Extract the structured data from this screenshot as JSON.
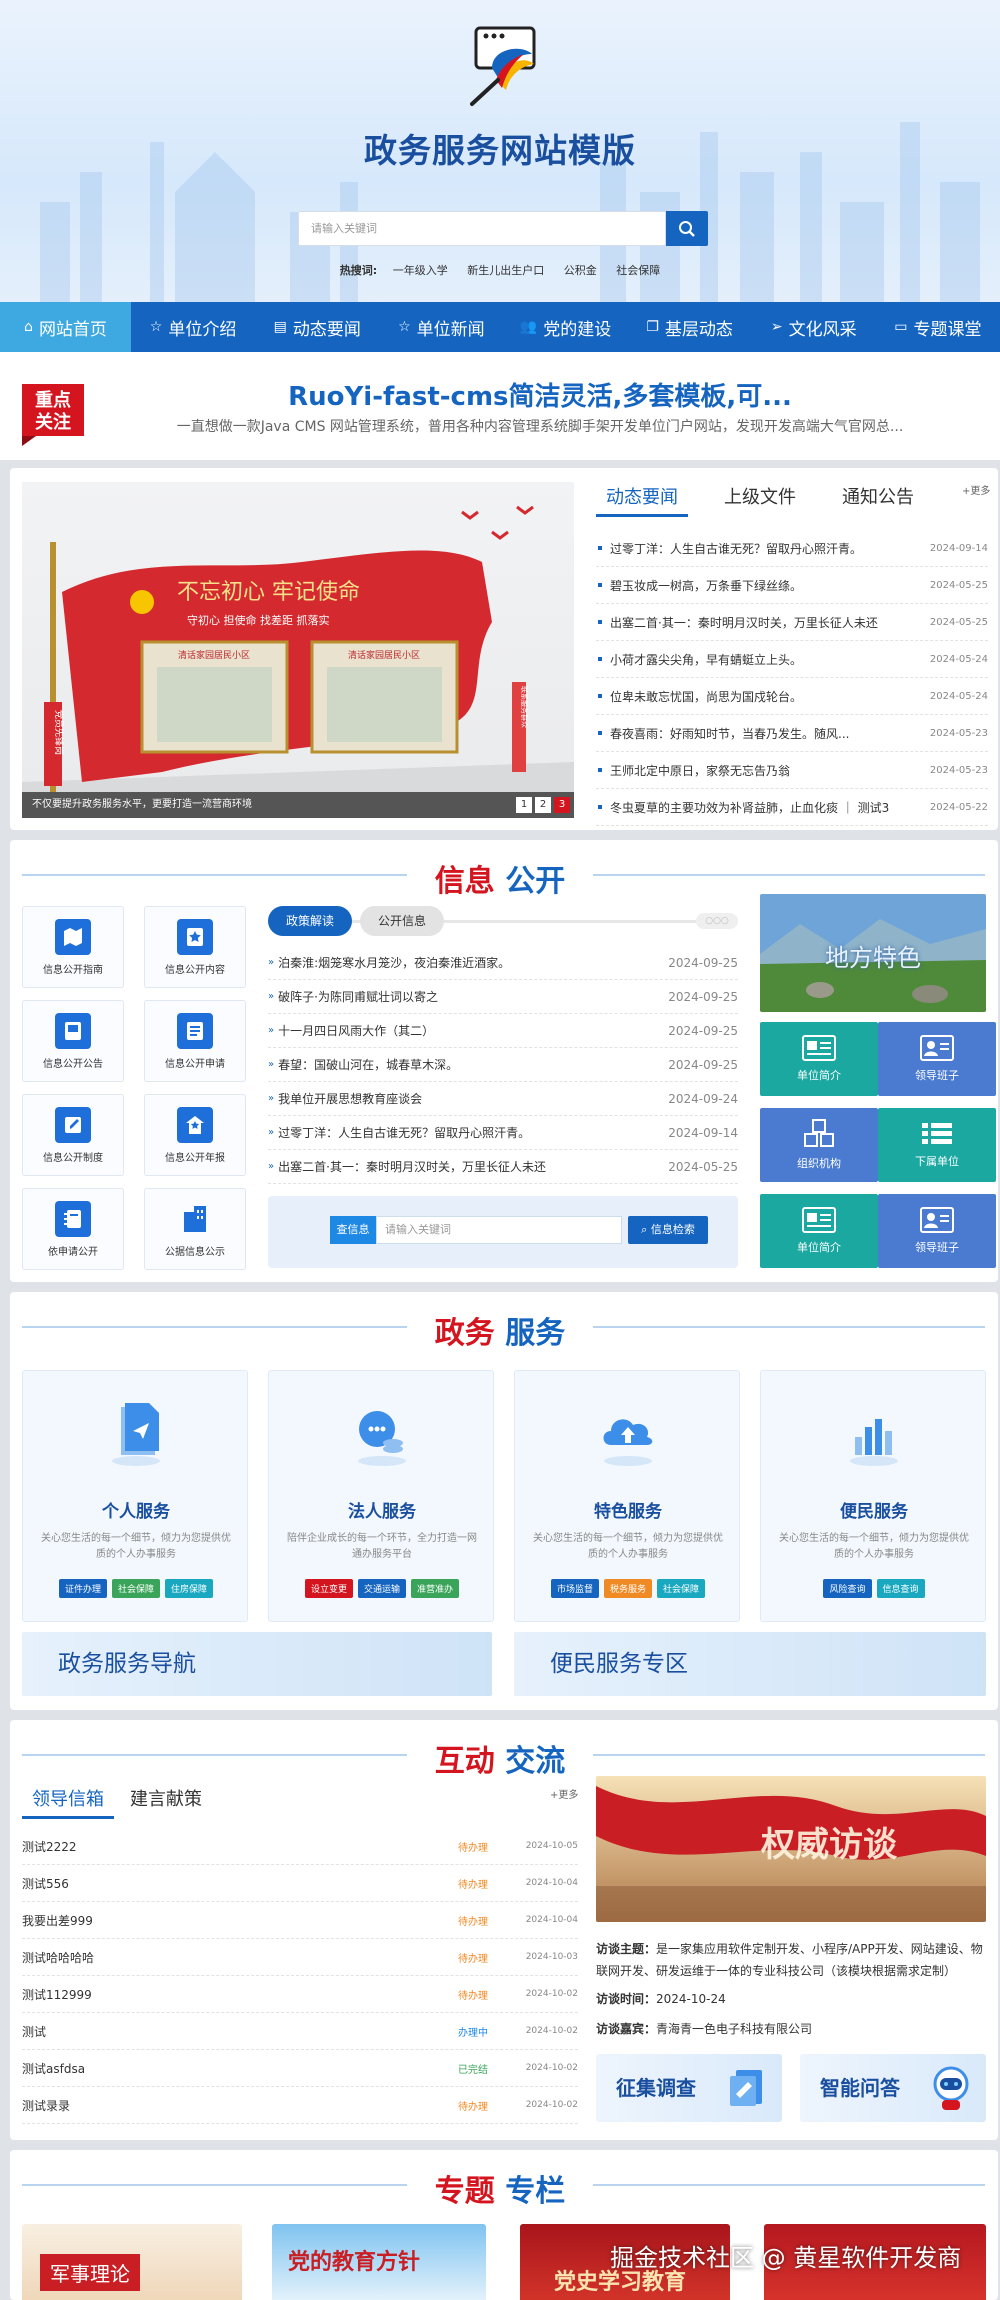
{
  "header": {
    "site_title": "政务服务网站模版",
    "search_placeholder": "请输入关键词",
    "hot_label": "热搜词:",
    "hot_words": [
      "一年级入学",
      "新生儿出生户口",
      "公积金",
      "社会保障"
    ]
  },
  "nav": {
    "items": [
      {
        "label": "网站首页",
        "icon": "home-icon"
      },
      {
        "label": "单位介绍",
        "icon": "star-icon"
      },
      {
        "label": "动态要闻",
        "icon": "news-icon"
      },
      {
        "label": "单位新闻",
        "icon": "star-icon"
      },
      {
        "label": "党的建设",
        "icon": "users-icon"
      },
      {
        "label": "基层动态",
        "icon": "copy-icon"
      },
      {
        "label": "文化风采",
        "icon": "send-icon"
      },
      {
        "label": "专题课堂",
        "icon": "laptop-icon"
      }
    ]
  },
  "focus": {
    "badge_line1": "重点",
    "badge_line2": "关注",
    "title": "RuoYi-fast-cms简洁灵活,多套模板,可...",
    "desc": "一直想做一款Java CMS 网站管理系统，普用各种内容管理系统脚手架开发单位门户网站，发现开发高端大气官网总..."
  },
  "carousel": {
    "caption": "不仅要提升政务服务水平，更要打造一流营商环境",
    "pages": [
      "1",
      "2",
      "3"
    ],
    "active_page": 3,
    "banner_text": "不忘初心 牢记使命",
    "banner_sub": "守初心 担使命 找差距 抓落实",
    "board_left": "清话家园居民小区",
    "board_right": "清话家园居民小区",
    "side_left": "党员先锋岗",
    "side_right": "联系服务群众"
  },
  "news": {
    "tabs": [
      "动态要闻",
      "上级文件",
      "通知公告"
    ],
    "more": "+更多",
    "items": [
      {
        "title": "过零丁洋：人生自古谁无死？留取丹心照汗青。",
        "date": "2024-09-14"
      },
      {
        "title": "碧玉妆成一树高，万条垂下绿丝绦。",
        "date": "2024-05-25"
      },
      {
        "title": "出塞二首·其一：秦时明月汉时关，万里长征人未还",
        "date": "2024-05-25"
      },
      {
        "title": "小荷才露尖尖角，早有蜻蜓立上头。",
        "date": "2024-05-24"
      },
      {
        "title": "位卑未敢忘忧国，尚思为国戍轮台。",
        "date": "2024-05-24"
      },
      {
        "title": "春夜喜雨：好雨知时节，当春乃发生。随风...",
        "date": "2024-05-23"
      },
      {
        "title": "王师北定中原日，家祭无忘告乃翁",
        "date": "2024-05-23"
      },
      {
        "title": "冬虫夏草的主要功效为补肾益肺，止血化痰 ｜ 测试3",
        "date": "2024-05-22"
      }
    ]
  },
  "info": {
    "title_red": "信息",
    "title_blue": "公开",
    "tiles": [
      {
        "label": "信息公开指南",
        "icon": "map-icon"
      },
      {
        "label": "信息公开内容",
        "icon": "star-doc-icon"
      },
      {
        "label": "信息公开公告",
        "icon": "book-icon"
      },
      {
        "label": "信息公开申请",
        "icon": "form-icon"
      },
      {
        "label": "信息公开制度",
        "icon": "edit-icon"
      },
      {
        "label": "信息公开年报",
        "icon": "house-icon"
      },
      {
        "label": "依申请公开",
        "icon": "notebook-icon"
      },
      {
        "label": "公据信息公示",
        "icon": "building-icon"
      }
    ],
    "tabs": [
      "政策解读",
      "公开信息"
    ],
    "items": [
      {
        "title": "泊秦淮:烟笼寒水月笼沙，夜泊秦淮近酒家。",
        "date": "2024-09-25"
      },
      {
        "title": "破阵子·为陈同甫赋壮词以寄之",
        "date": "2024-09-25"
      },
      {
        "title": "十一月四日风雨大作（其二）",
        "date": "2024-09-25"
      },
      {
        "title": "春望：国破山河在，城春草木深。",
        "date": "2024-09-25"
      },
      {
        "title": "我单位开展思想教育座谈会",
        "date": "2024-09-24"
      },
      {
        "title": "过零丁洋：人生自古谁无死？留取丹心照汗青。",
        "date": "2024-09-14"
      },
      {
        "title": "出塞二首·其一：秦时明月汉时关，万里长征人未还",
        "date": "2024-05-25"
      }
    ],
    "search_tag": "查信息",
    "search_placeholder": "请输入关键词",
    "search_button": "信息检索",
    "local_feature": "地方特色",
    "squares": [
      {
        "label": "单位简介",
        "color": "#1aa8a0",
        "icon": "id-icon"
      },
      {
        "label": "领导班子",
        "color": "#4a7bd0",
        "icon": "person-card-icon"
      },
      {
        "label": "组织机构",
        "color": "#4a7bd0",
        "icon": "cubes-icon"
      },
      {
        "label": "下属单位",
        "color": "#1aa8a0",
        "icon": "list-icon"
      },
      {
        "label": "单位简介",
        "color": "#1aa8a0",
        "icon": "id-icon"
      },
      {
        "label": "领导班子",
        "color": "#4a7bd0",
        "icon": "person-card-icon"
      }
    ]
  },
  "services": {
    "title_red": "政务",
    "title_blue": "服务",
    "cards": [
      {
        "title": "个人服务",
        "desc": "关心您生活的每一个细节，倾力为您提供优质的个人办事服务",
        "tags": [
          {
            "t": "证件办理",
            "c": "#1565c0"
          },
          {
            "t": "社会保障",
            "c": "#3aa55a"
          },
          {
            "t": "住房保障",
            "c": "#1aa8c0"
          }
        ]
      },
      {
        "title": "法人服务",
        "desc": "陪伴企业成长的每一个环节，全力打造一网通办服务平台",
        "tags": [
          {
            "t": "设立变更",
            "c": "#d4151f"
          },
          {
            "t": "交通运输",
            "c": "#1565c0"
          },
          {
            "t": "准营准办",
            "c": "#3aa55a"
          }
        ]
      },
      {
        "title": "特色服务",
        "desc": "关心您生活的每一个细节，倾力为您提供优质的个人办事服务",
        "tags": [
          {
            "t": "市场监督",
            "c": "#1565c0"
          },
          {
            "t": "税务服务",
            "c": "#f08a24"
          },
          {
            "t": "社会保障",
            "c": "#1aa8c0"
          }
        ]
      },
      {
        "title": "便民服务",
        "desc": "关心您生活的每一个细节，倾力为您提供优质的个人办事服务",
        "tags": [
          {
            "t": "风险查询",
            "c": "#1565c0"
          },
          {
            "t": "信息查询",
            "c": "#1aa8c0"
          }
        ]
      }
    ],
    "nav_left": "政务服务导航",
    "nav_right": "便民服务专区"
  },
  "interaction": {
    "title_red": "互动",
    "title_blue": "交流",
    "tabs": [
      "领导信箱",
      "建言献策"
    ],
    "more": "+更多",
    "items": [
      {
        "title": "测试2222",
        "status": "待办理",
        "sc": "#f08a24",
        "date": "2024-10-05"
      },
      {
        "title": "测试556",
        "status": "待办理",
        "sc": "#f08a24",
        "date": "2024-10-04"
      },
      {
        "title": "我要出差999",
        "status": "待办理",
        "sc": "#f08a24",
        "date": "2024-10-04"
      },
      {
        "title": "测试哈哈哈哈",
        "status": "待办理",
        "sc": "#f08a24",
        "date": "2024-10-03"
      },
      {
        "title": "测试112999",
        "status": "待办理",
        "sc": "#f08a24",
        "date": "2024-10-02"
      },
      {
        "title": "测试",
        "status": "办理中",
        "sc": "#1e88e5",
        "date": "2024-10-02"
      },
      {
        "title": "测试asfdsa",
        "status": "已完结",
        "sc": "#3aa55a",
        "date": "2024-10-02"
      },
      {
        "title": "测试录录",
        "status": "待办理",
        "sc": "#f08a24",
        "date": "2024-10-02"
      }
    ],
    "interview_art": "权威访谈",
    "interview_topic_label": "访谈主题：",
    "interview_topic": "是一家集应用软件定制开发、小程序/APP开发、网站建设、物联网开发、研发运维于一体的专业科技公司（该模块根据需求定制）",
    "interview_time_label": "访谈时间：",
    "interview_time": "2024-10-24",
    "interview_guest_label": "访谈嘉宾：",
    "interview_guest": "青海青一色电子科技有限公司",
    "survey": "征集调查",
    "qa": "智能问答"
  },
  "topics": {
    "title_red": "专题",
    "title_blue": "专栏",
    "cards": [
      "军事理论",
      "党的教育方针",
      "党史学习教育",
      ""
    ]
  },
  "watermark": "掘金技术社区 @ 黄星软件开发商"
}
